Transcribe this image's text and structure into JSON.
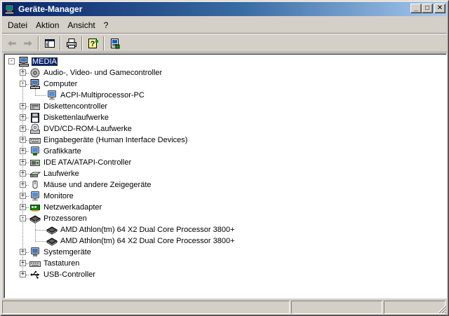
{
  "window": {
    "title": "Geräte-Manager",
    "minimize_glyph": "_",
    "maximize_glyph": "□",
    "close_glyph": "✕"
  },
  "menu": [
    {
      "label": "Datei"
    },
    {
      "label": "Aktion"
    },
    {
      "label": "Ansicht"
    },
    {
      "label": "?"
    }
  ],
  "toolbar": {
    "back_icon": "back-arrow-icon",
    "forward_icon": "forward-arrow-icon",
    "tree_view_icon": "show-hide-console-tree-icon",
    "print_icon": "printer-icon",
    "help_icon": "help-icon",
    "properties_icon": "properties-icon"
  },
  "tree": {
    "root": {
      "label": "MEDIA",
      "expander": "−",
      "icon": "computer-icon"
    },
    "categories": [
      {
        "label": "Audio-, Video- und Gamecontroller",
        "expander": "+",
        "icon": "sound-icon"
      },
      {
        "label": "Computer",
        "expander": "−",
        "icon": "computer-icon",
        "children": [
          {
            "label": "ACPI-Multiprocessor-PC",
            "icon": "monitor-icon"
          }
        ]
      },
      {
        "label": "Diskettencontroller",
        "expander": "+",
        "icon": "floppy-controller-icon"
      },
      {
        "label": "Diskettenlaufwerke",
        "expander": "+",
        "icon": "floppy-drive-icon"
      },
      {
        "label": "DVD/CD-ROM-Laufwerke",
        "expander": "+",
        "icon": "cdrom-icon"
      },
      {
        "label": "Eingabegeräte (Human Interface Devices)",
        "expander": "+",
        "icon": "keyboard-icon"
      },
      {
        "label": "Grafikkarte",
        "expander": "+",
        "icon": "display-adapter-icon"
      },
      {
        "label": "IDE ATA/ATAPI-Controller",
        "expander": "+",
        "icon": "ide-controller-icon"
      },
      {
        "label": "Laufwerke",
        "expander": "+",
        "icon": "disk-drive-icon"
      },
      {
        "label": "Mäuse und andere Zeigegeräte",
        "expander": "+",
        "icon": "mouse-icon"
      },
      {
        "label": "Monitore",
        "expander": "+",
        "icon": "monitor-icon"
      },
      {
        "label": "Netzwerkadapter",
        "expander": "+",
        "icon": "network-adapter-icon"
      },
      {
        "label": "Prozessoren",
        "expander": "−",
        "icon": "processor-icon",
        "children": [
          {
            "label": "AMD Athlon(tm) 64 X2 Dual Core Processor 3800+",
            "icon": "processor-icon"
          },
          {
            "label": "AMD Athlon(tm) 64 X2 Dual Core Processor 3800+",
            "icon": "processor-icon"
          }
        ]
      },
      {
        "label": "Systemgeräte",
        "expander": "+",
        "icon": "system-device-icon"
      },
      {
        "label": "Tastaturen",
        "expander": "+",
        "icon": "keyboard-icon"
      },
      {
        "label": "USB-Controller",
        "expander": "+",
        "icon": "usb-icon"
      }
    ]
  },
  "colors": {
    "title_gradient_start": "#0a246a",
    "title_gradient_end": "#a6caf0",
    "selection": "#0a246a",
    "face": "#d4d0c8"
  }
}
